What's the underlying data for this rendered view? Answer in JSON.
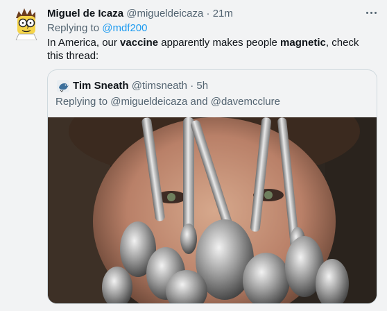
{
  "tweet": {
    "display_name": "Miguel de Icaza",
    "handle": "@migueldeicaza",
    "separator": "·",
    "time": "21m",
    "replying_prefix": "Replying to ",
    "replying_to": "@mdf200",
    "text_part1": "In America, our ",
    "text_bold1": "vaccine",
    "text_part2": " apparently makes people ",
    "text_bold2": "magnetic",
    "text_part3": ", check this thread:",
    "avatar_icon": "cartoon-avatar-icon",
    "more_icon": "more-options-icon"
  },
  "quote": {
    "display_name": "Tim Sneath",
    "handle": "@timsneath",
    "separator": "·",
    "time": "5h",
    "replying_prefix": "Replying to ",
    "replying_to_1": "@migueldeicaza",
    "replying_and": " and ",
    "replying_to_2": "@davemcclure",
    "avatar_icon": "bird-avatar-icon"
  },
  "colors": {
    "background": "#f2f3f4",
    "link": "#1d9bf0",
    "secondary_text": "#536471",
    "border": "#cfd9de"
  }
}
